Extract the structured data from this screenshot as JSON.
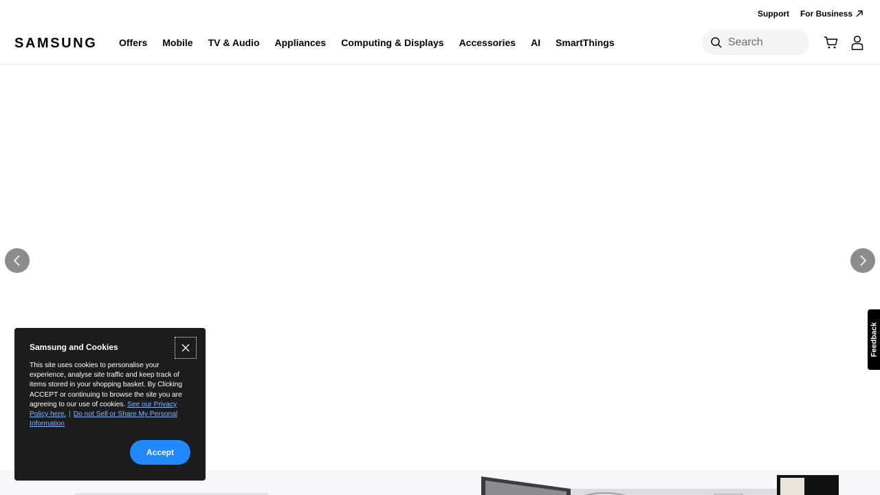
{
  "utility": {
    "support": "Support",
    "for_business": "For Business"
  },
  "brand": {
    "logo": "SAMSUNG"
  },
  "nav": {
    "items": [
      "Offers",
      "Mobile",
      "TV & Audio",
      "Appliances",
      "Computing & Displays",
      "Accessories",
      "AI",
      "SmartThings"
    ]
  },
  "search": {
    "placeholder": "Search"
  },
  "icons": {
    "search": "search-icon",
    "cart": "cart-icon",
    "account": "user-icon",
    "external": "external-link-icon",
    "prev": "chevron-left-icon",
    "next": "chevron-right-icon",
    "close": "close-icon"
  },
  "feedback": {
    "label": "Feedback"
  },
  "cookie": {
    "title": "Samsung and Cookies",
    "body": "This site uses cookies to personalise your experience, analyse site traffic and keep track of items stored in your shopping basket. By Clicking ACCEPT or continuing to browse the site you are agreeing to our use of cookies.",
    "privacy_link": "See our Privacy Policy here.",
    "separator": "|",
    "do_not_sell_link": "Do not Sell or Share My Personal Information",
    "accept_label": "Accept"
  },
  "colors": {
    "accent": "#2189ff",
    "dialog_bg": "#1c1c1c",
    "link": "#7db7ff",
    "search_bg": "#f4f4f4"
  }
}
